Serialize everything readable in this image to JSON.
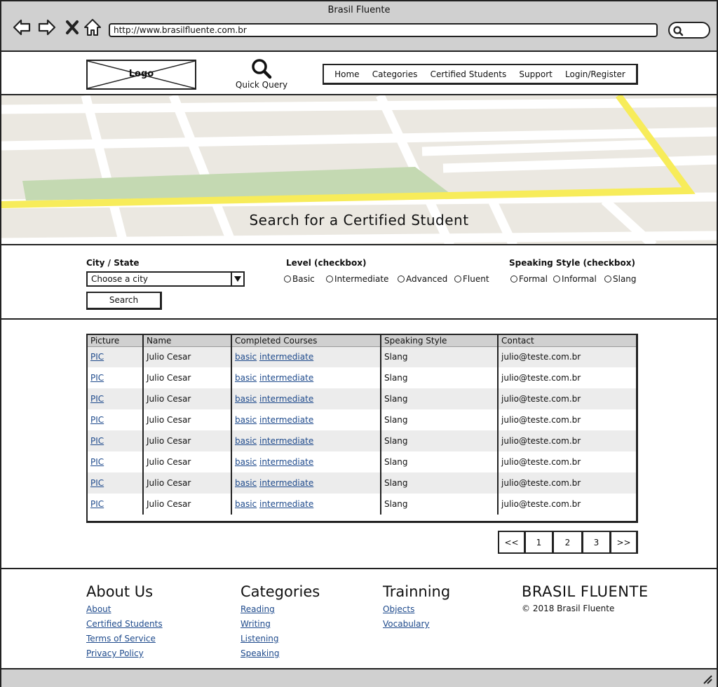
{
  "browser": {
    "title": "Brasil Fluente",
    "url": "http://www.brasilfluente.com.br"
  },
  "header": {
    "logo_label": "Logo",
    "quick_query": "Quick Query",
    "nav": [
      "Home",
      "Categories",
      "Certified Students",
      "Support",
      "Login/Register"
    ]
  },
  "hero": {
    "title": "Search for a Certified Student"
  },
  "filters": {
    "city_label": "City / State",
    "city_placeholder": "Choose a city",
    "level_label": "Level (checkbox)",
    "levels": [
      "Basic",
      "Intermediate",
      "Advanced",
      "Fluent"
    ],
    "style_label": "Speaking Style (checkbox)",
    "styles": [
      "Formal",
      "Informal",
      "Slang"
    ],
    "search_button": "Search"
  },
  "table": {
    "headers": [
      "Picture",
      "Name",
      "Completed Courses",
      "Speaking Style",
      "Contact"
    ],
    "rows": [
      {
        "picture": "PIC",
        "name": "Julio Cesar",
        "course1": "basic",
        "course2": "intermediate",
        "style": "Slang",
        "contact": "julio@teste.com.br"
      },
      {
        "picture": "PIC",
        "name": "Julio Cesar",
        "course1": "basic",
        "course2": "intermediate",
        "style": "Slang",
        "contact": "julio@teste.com.br"
      },
      {
        "picture": "PIC",
        "name": "Julio Cesar",
        "course1": "basic",
        "course2": "intermediate",
        "style": "Slang",
        "contact": "julio@teste.com.br"
      },
      {
        "picture": "PIC",
        "name": "Julio Cesar",
        "course1": "basic",
        "course2": "intermediate",
        "style": "Slang",
        "contact": "julio@teste.com.br"
      },
      {
        "picture": "PIC",
        "name": "Julio Cesar",
        "course1": "basic",
        "course2": "intermediate",
        "style": "Slang",
        "contact": "julio@teste.com.br"
      },
      {
        "picture": "PIC",
        "name": "Julio Cesar",
        "course1": "basic",
        "course2": "intermediate",
        "style": "Slang",
        "contact": "julio@teste.com.br"
      },
      {
        "picture": "PIC",
        "name": "Julio Cesar",
        "course1": "basic",
        "course2": "intermediate",
        "style": "Slang",
        "contact": "julio@teste.com.br"
      },
      {
        "picture": "PIC",
        "name": "Julio Cesar",
        "course1": "basic",
        "course2": "intermediate",
        "style": "Slang",
        "contact": "julio@teste.com.br"
      }
    ]
  },
  "pagination": [
    "<<",
    "1",
    "2",
    "3",
    ">>"
  ],
  "footer": {
    "about": {
      "title": "About Us",
      "links": [
        "About",
        "Certified Students",
        "Terms of Service",
        "Privacy Policy"
      ]
    },
    "categories": {
      "title": "Categories",
      "links": [
        "Reading",
        "Writing",
        "Listening",
        "Speaking"
      ]
    },
    "training": {
      "title": "Trainning",
      "links": [
        "Objects",
        "Vocabulary"
      ]
    },
    "brand": {
      "title": "BRASIL FLUENTE",
      "copyright": "© 2018 Brasil Fluente"
    }
  },
  "colors": {
    "chrome": "#d0d0d0",
    "link": "#1e4a8c",
    "map_bg": "#ebe8e1",
    "map_road_yellow": "#f7ec5a",
    "map_park": "#c4d9b2"
  }
}
